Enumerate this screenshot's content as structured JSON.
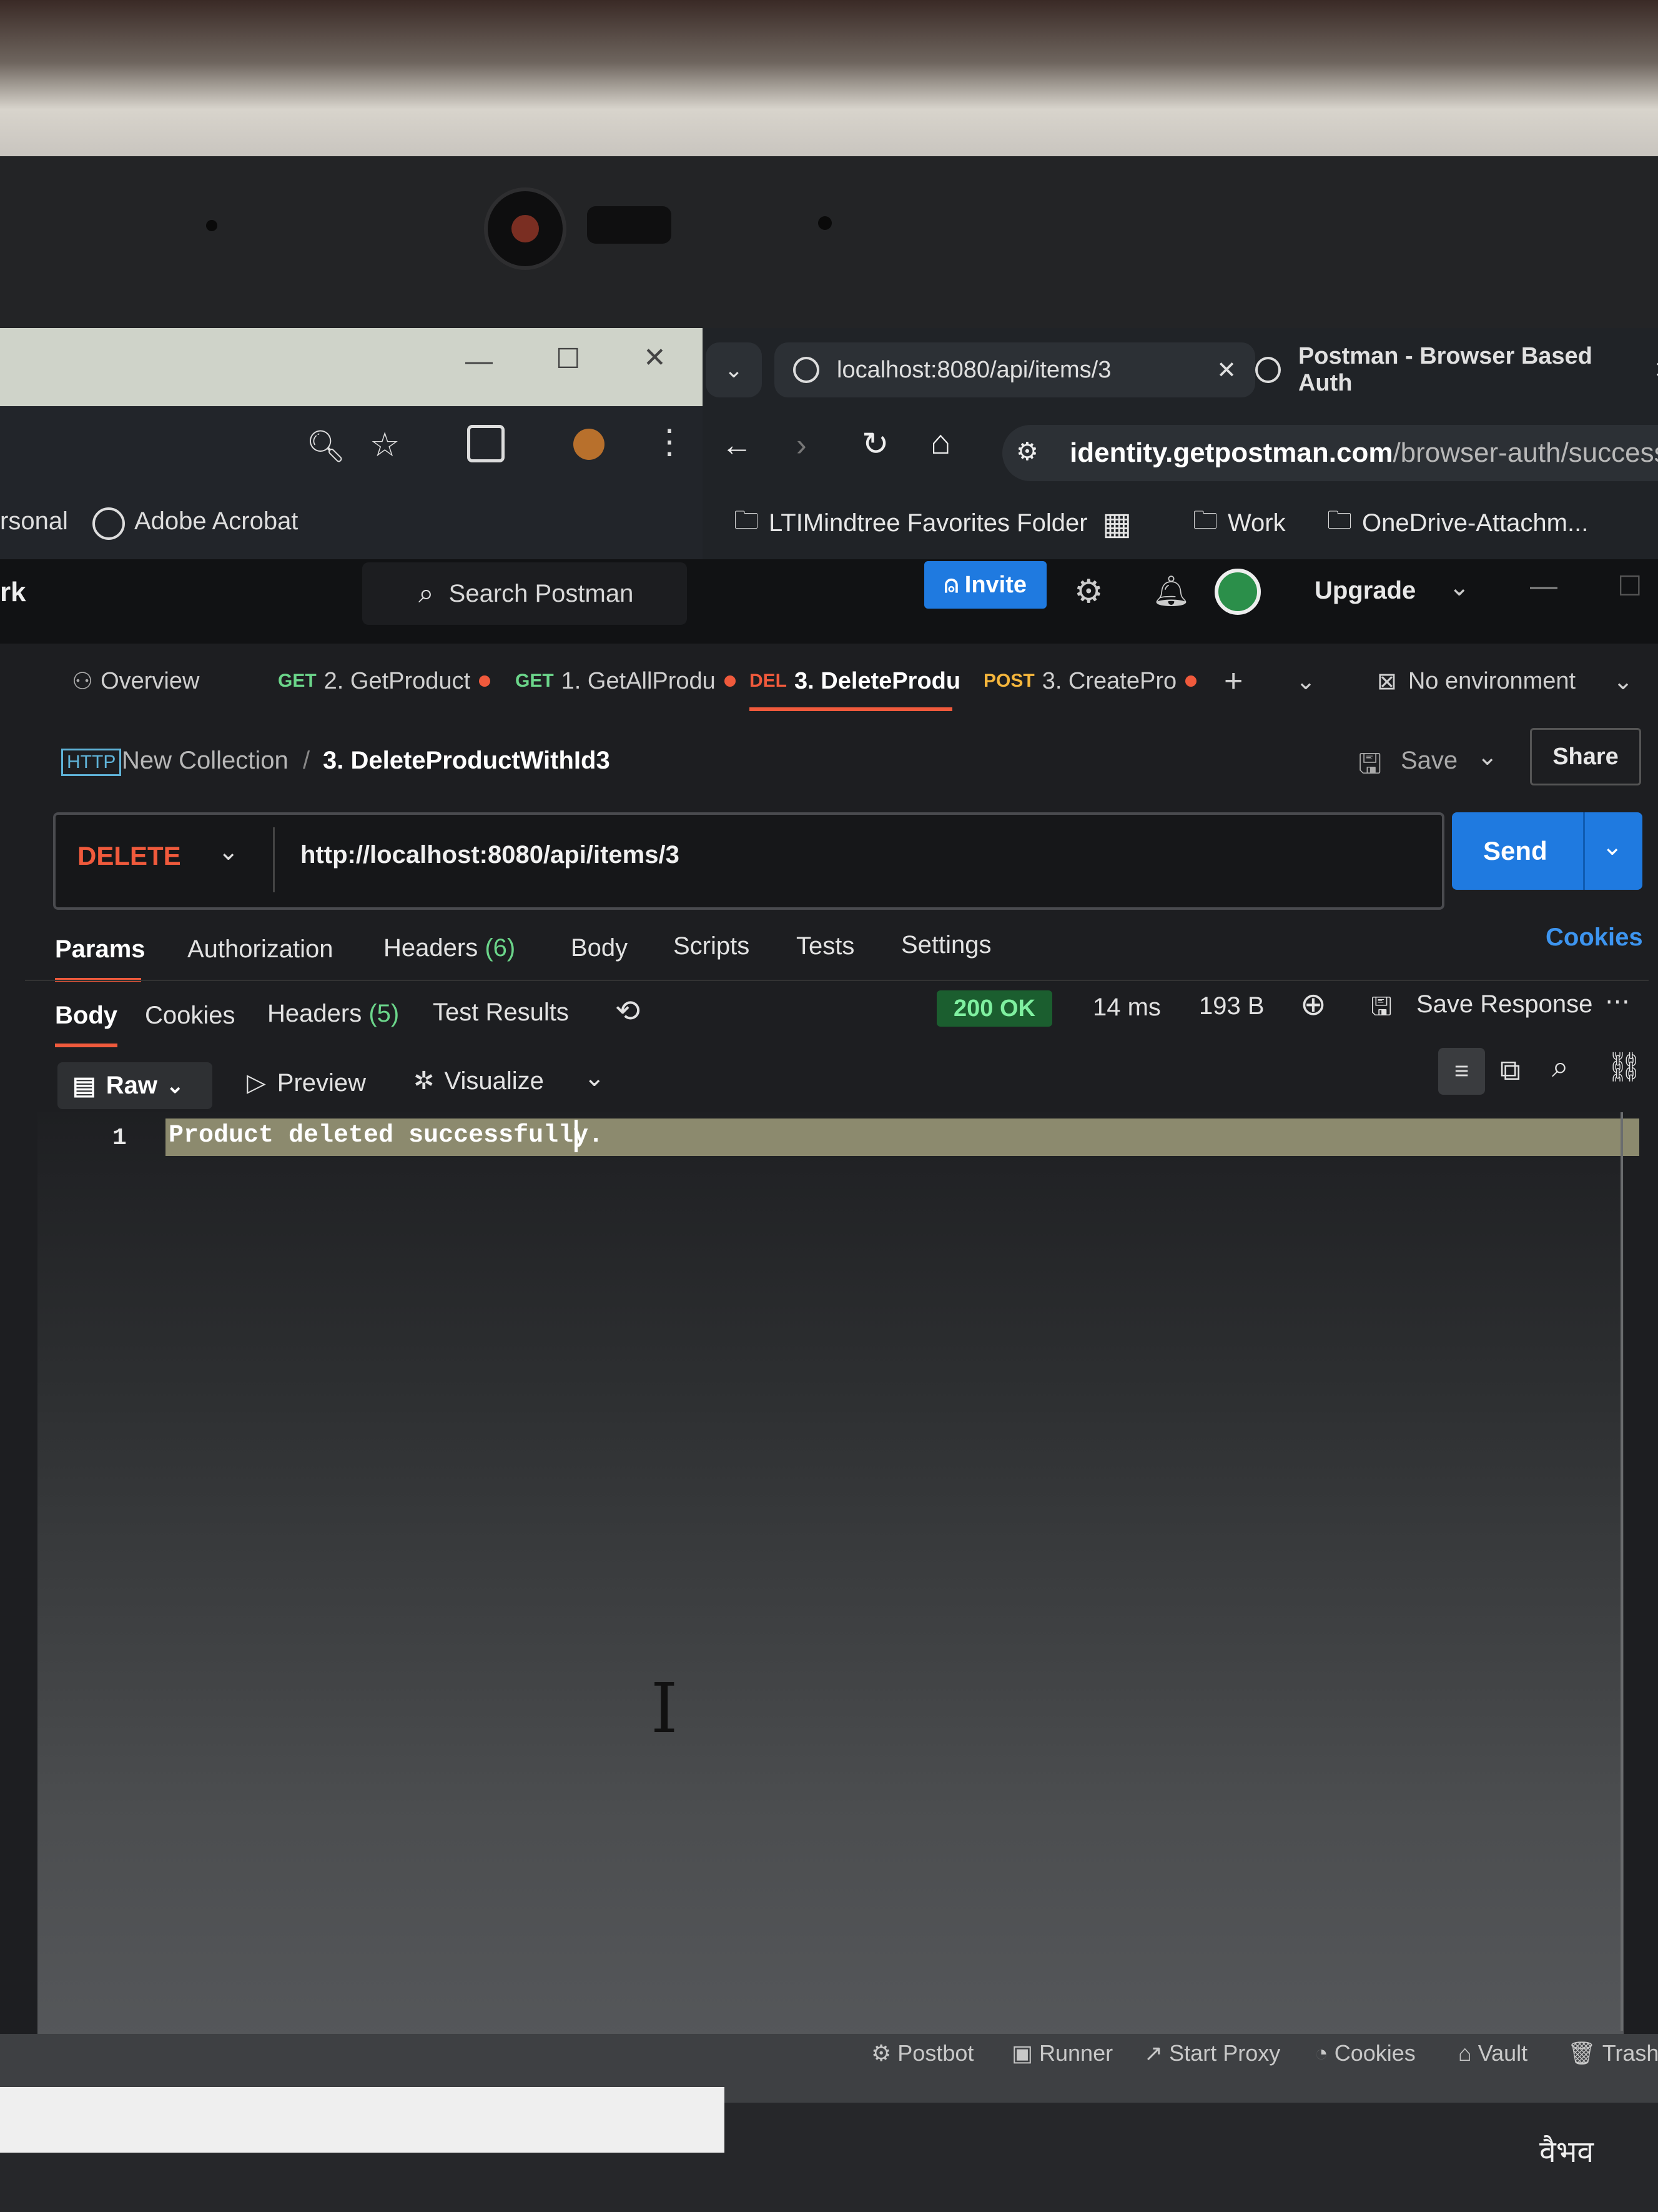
{
  "browser": {
    "tabs": [
      {
        "label": "localhost:8080/api/items/3"
      },
      {
        "label": "Postman - Browser Based Auth"
      }
    ],
    "address": {
      "host": "identity.getpostman.com",
      "path": "/browser-auth/success?re"
    },
    "bookmarks_left": [
      "rsonal",
      "Adobe Acrobat"
    ],
    "bookmarks": [
      "LTIMindtree Favorites Folder",
      "Work",
      "OneDrive-Attachm..."
    ]
  },
  "postman": {
    "workspace_label": "rk",
    "search_placeholder": "Search Postman",
    "invite_label": "Invite",
    "upgrade_label": "Upgrade",
    "request_tabs": [
      {
        "label": "Overview"
      },
      {
        "method": "GET",
        "label": "2. GetProduct"
      },
      {
        "method": "GET",
        "label": "1. GetAllProdu"
      },
      {
        "method": "DEL",
        "label": "3. DeleteProdu"
      },
      {
        "method": "POST",
        "label": "3. CreatePro"
      }
    ],
    "environment": "No environment",
    "breadcrumb": {
      "collection": "New Collection",
      "separator": "/",
      "request": "3. DeleteProductWithId3"
    },
    "save_label": "Save",
    "share_label": "Share",
    "method": "DELETE",
    "url": "http://localhost:8080/api/items/3",
    "send_label": "Send",
    "request_subtabs": [
      "Params",
      "Authorization",
      "Headers",
      "Body",
      "Scripts",
      "Tests",
      "Settings"
    ],
    "request_headers_count": "(6)",
    "cookies_link": "Cookies",
    "response_tabs": [
      "Body",
      "Cookies",
      "Headers",
      "Test Results"
    ],
    "response_headers_count": "(5)",
    "status": "200 OK",
    "time": "14 ms",
    "size": "193 B",
    "save_response": "Save Response",
    "view_modes": [
      "Raw",
      "Preview",
      "Visualize"
    ],
    "response_body": {
      "line_number": "1",
      "text": "Product deleted successfully."
    },
    "footer": [
      "Postbot",
      "Runner",
      "Start Proxy",
      "Cookies",
      "Vault",
      "Trash"
    ]
  },
  "signature": "वैभव",
  "colors": {
    "accent": "#1f7ae0",
    "delete": "#f05a3c",
    "get": "#6bd58a",
    "post": "#f5b63c",
    "status_ok": "#1b5e2f"
  }
}
